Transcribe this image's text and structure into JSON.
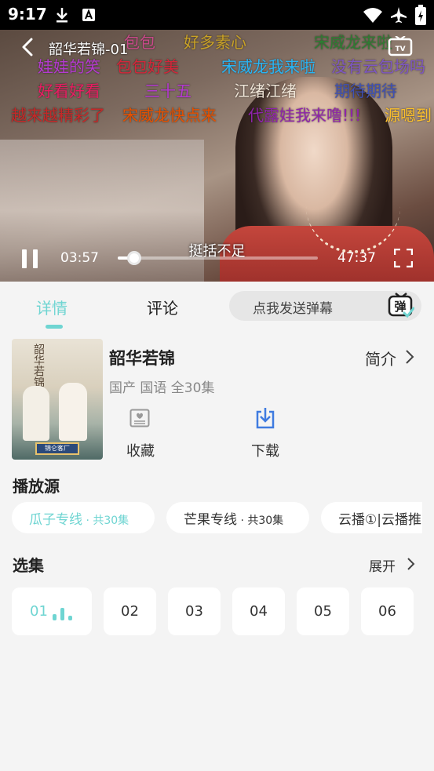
{
  "status_bar": {
    "time": "9:17"
  },
  "player": {
    "title": "韶华若锦-01",
    "subtitle": "挺括不足",
    "current_time": "03:57",
    "total_time": "47:37",
    "progress": 0.083,
    "danmaku": [
      {
        "text": "包包",
        "color": "#c94a8a"
      },
      {
        "text": "好多素心",
        "color": "#c9a227"
      },
      {
        "text": "宋威龙来啦",
        "color": "#2e7d32"
      },
      {
        "text": "娃娃的笑",
        "color": "#b53ad1"
      },
      {
        "text": "包包好美",
        "color": "#d4273a"
      },
      {
        "text": "宋威龙我来啦",
        "color": "#29b6f6"
      },
      {
        "text": "没有云包场吗",
        "color": "#7e57c2"
      },
      {
        "text": "好看好看",
        "color": "#e91e63"
      },
      {
        "text": "三十五",
        "color": "#b53ad1"
      },
      {
        "text": "江绪江绪",
        "color": "#f0e6d8"
      },
      {
        "text": "期待期待",
        "color": "#3f51b5"
      },
      {
        "text": "越来越精彩了",
        "color": "#c62828"
      },
      {
        "text": "宋威龙快点来",
        "color": "#e65100"
      },
      {
        "text": "代露娃我来噜!!!",
        "color": "#8e24aa"
      },
      {
        "text": "源嗯到",
        "color": "#fbc02d"
      }
    ]
  },
  "tabs": {
    "detail": "详情",
    "comment": "评论"
  },
  "danmaku_input": {
    "placeholder": "点我发送弹幕",
    "toggle_label": "弹"
  },
  "show": {
    "title": "韶华若锦",
    "meta": "国产 国语 全30集",
    "intro_label": "简介",
    "poster_title": "韶华若锦",
    "poster_badge": "锦仑客厂"
  },
  "actions": {
    "favorite": "收藏",
    "download": "下载"
  },
  "sources": {
    "title": "播放源",
    "items": [
      {
        "name": "瓜子专线",
        "count": " · 共30集",
        "active": true
      },
      {
        "name": "芒果专线",
        "count": " · 共30集",
        "active": false
      },
      {
        "name": "云播①|云播推",
        "count": "",
        "active": false
      }
    ]
  },
  "episodes": {
    "title": "选集",
    "expand_label": "展开",
    "items": [
      "01",
      "02",
      "03",
      "04",
      "05",
      "06"
    ],
    "current": "01"
  },
  "colors": {
    "accent": "#6fd5d2",
    "background": "#f4f4f4",
    "download_icon": "#3f7be0"
  }
}
